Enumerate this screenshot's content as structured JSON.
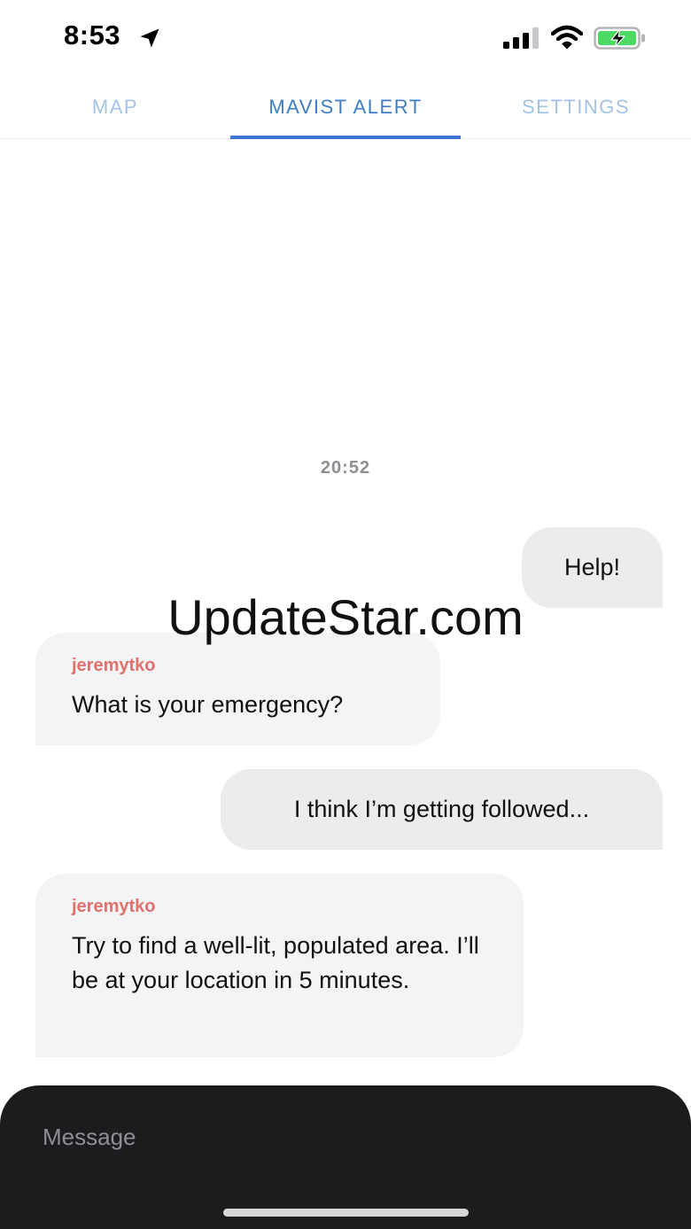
{
  "status_bar": {
    "time": "8:53",
    "location_icon": "location-arrow-icon",
    "signal_icon": "cellular-signal-icon",
    "wifi_icon": "wifi-icon",
    "battery_icon": "battery-charging-icon",
    "battery_color": "#4cd964"
  },
  "tabs": [
    {
      "label": "MAP",
      "active": false
    },
    {
      "label": "MAVIST ALERT",
      "active": true
    },
    {
      "label": "SETTINGS",
      "active": false
    }
  ],
  "colors": {
    "tab_active": "#3f7dc3",
    "tab_inactive": "#a3c3e4",
    "sender": "#e0716a",
    "composer_bg": "#1c1c1e"
  },
  "chat": {
    "timestamp": "20:52",
    "messages": [
      {
        "direction": "outgoing",
        "text": "Help!"
      },
      {
        "direction": "incoming",
        "sender": "jeremytko",
        "text": "What is your emergency?"
      },
      {
        "direction": "outgoing",
        "text": "I think I’m getting followed..."
      },
      {
        "direction": "incoming",
        "sender": "jeremytko",
        "text": "Try to find a well-lit, populated area. I’ll be at your location in 5 minutes."
      }
    ]
  },
  "watermark": "UpdateStar.com",
  "composer": {
    "placeholder": "Message",
    "value": ""
  }
}
